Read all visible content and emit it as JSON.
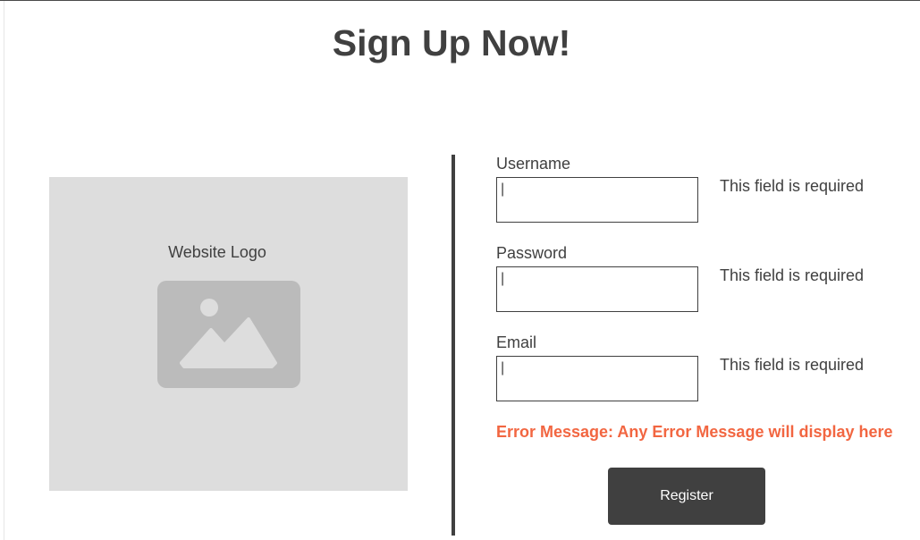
{
  "page": {
    "title": "Sign Up Now!"
  },
  "logo": {
    "label": "Website Logo",
    "icon": "image-placeholder-icon"
  },
  "form": {
    "fields": [
      {
        "label": "Username",
        "value": "|",
        "hint": "This field is required"
      },
      {
        "label": "Password",
        "value": "|",
        "hint": "This field is required"
      },
      {
        "label": "Email",
        "value": "|",
        "hint": "This field is required"
      }
    ],
    "error_message": "Error Message: Any Error Message will display here",
    "register_label": "Register"
  },
  "colors": {
    "text": "#404040",
    "panel": "#dddddd",
    "icon": "#bbbbbb",
    "error": "#f26641",
    "button": "#404040"
  }
}
